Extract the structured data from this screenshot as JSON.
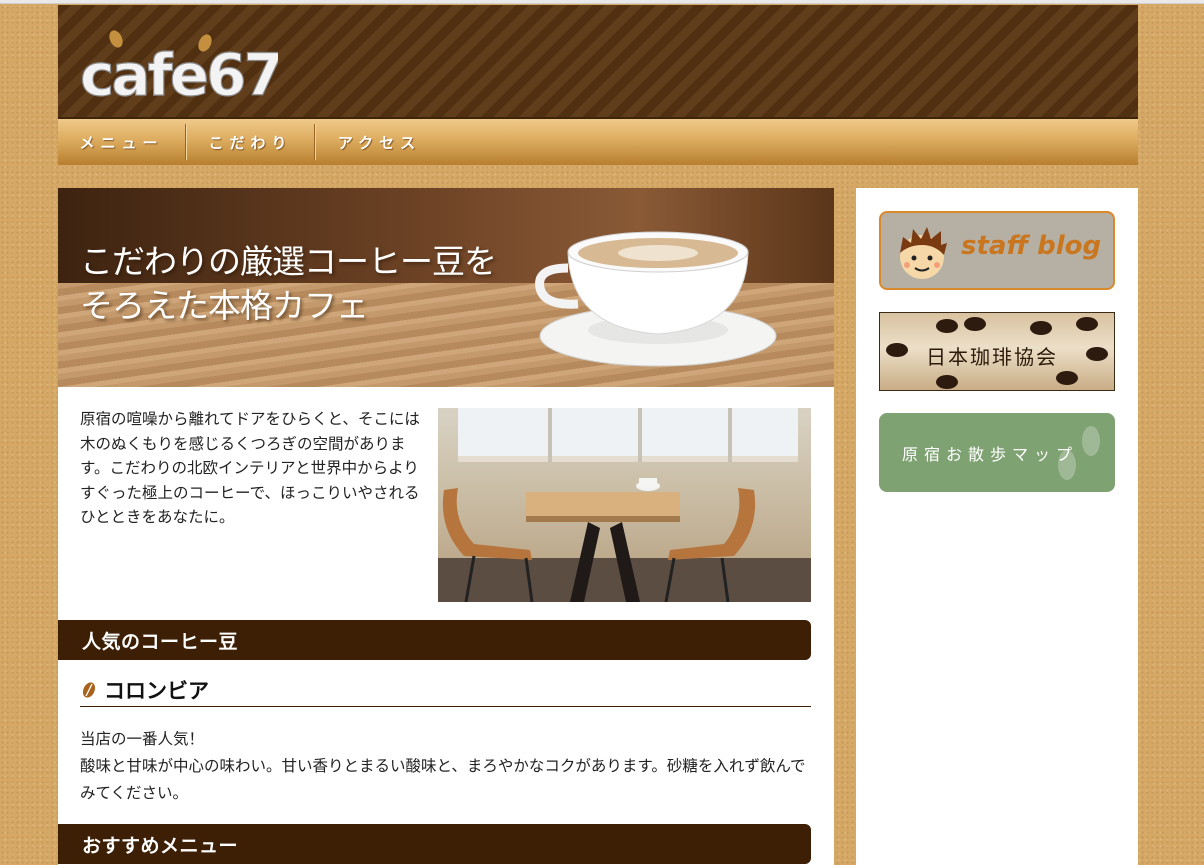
{
  "header": {
    "logo_text": "cafe67"
  },
  "nav": {
    "items": [
      "メニュー",
      "こだわり",
      "アクセス"
    ]
  },
  "hero": {
    "line1": "こだわりの厳選コーヒー豆を",
    "line2": "そろえた本格カフェ"
  },
  "intro": {
    "text": "原宿の喧噪から離れてドアをひらくと、そこには木のぬくもりを感じるくつろぎの空間があります。こだわりの北欧インテリアと世界中からよりすぐった極上のコーヒーで、ほっこりいやされるひとときをあなたに。"
  },
  "sections": {
    "popular_title": "人気のコーヒー豆",
    "item_title": "コロンビア",
    "item_desc_line1": "当店の一番人気！",
    "item_desc_line2": "酸味と甘味が中心の味わい。甘い香りとまるい酸味と、まろやかなコクがあります。砂糖を入れず飲んでみてください。",
    "recommend_title": "おすすめメニュー"
  },
  "sidebar": {
    "staff_blog": "staff blog",
    "association": "日本珈琲協会",
    "walk_map": "原宿お散歩マップ"
  },
  "colors": {
    "header_brown": "#5a3613",
    "nav_gold": "#ddac5f",
    "section_bar": "#3c1f05",
    "staff_orange": "#d98a2b",
    "walk_green": "#7fa273"
  }
}
